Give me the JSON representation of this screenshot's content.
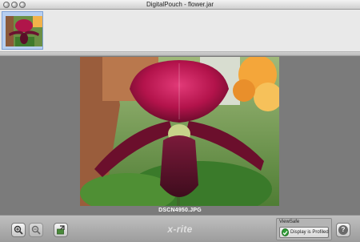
{
  "window": {
    "title": "DigitalPouch - flower.jar"
  },
  "viewer": {
    "filename": "DSCN4950.JPG"
  },
  "bottom": {
    "brand": "x-rite",
    "viewsafe_label": "ViewSafe",
    "viewsafe_status": "Display is Profiled",
    "help_label": "?"
  },
  "icons": {
    "zoom_in": "zoom-in-icon",
    "zoom_out": "zoom-out-icon",
    "export": "export-icon",
    "check": "check-icon",
    "help": "help-icon"
  },
  "colors": {
    "selection": "#b7cff0",
    "viewer_bg": "#7b7b7b",
    "status_ok": "#2f9e36"
  }
}
